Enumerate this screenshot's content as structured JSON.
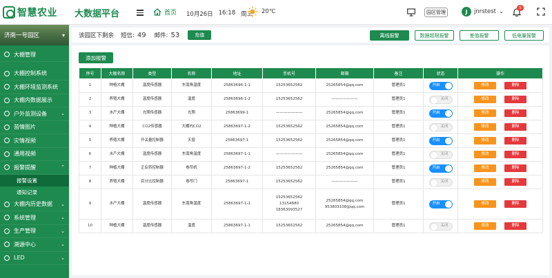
{
  "header": {
    "logo_text": "智慧农业",
    "platform_title": "大数据平台",
    "home_label": "首页",
    "date": "10月26日",
    "time": "16:18",
    "weekday": "周三",
    "temperature": "20℃",
    "park_manage_label": "园区管理",
    "avatar_letter": "J",
    "username": "jnrstest",
    "bell_count": "5"
  },
  "sidebar": {
    "park_name": "济南一号园区",
    "items": [
      {
        "label": "大棚管理",
        "arrow": ""
      },
      {
        "label": "大棚控制系统",
        "arrow": ""
      },
      {
        "label": "大棚环境监测系统",
        "arrow": ""
      },
      {
        "label": "大棚内数据展示",
        "arrow": ""
      },
      {
        "label": "户外监测设备",
        "arrow": "⌄"
      },
      {
        "label": "苗情图片",
        "arrow": ""
      },
      {
        "label": "灾情视频",
        "arrow": ""
      },
      {
        "label": "通用视频",
        "arrow": ""
      },
      {
        "label": "报警提醒",
        "arrow": "⌃"
      },
      {
        "label": "大棚内历史数据",
        "arrow": "⌄"
      },
      {
        "label": "系统管理",
        "arrow": "⌄"
      },
      {
        "label": "生产管理",
        "arrow": "⌄"
      },
      {
        "label": "溯源中心",
        "arrow": "⌄"
      },
      {
        "label": "LED",
        "arrow": "⌄"
      }
    ],
    "sub_items": [
      "报警设置",
      "通知记录"
    ]
  },
  "info_bar": {
    "remaining_label": "该园区下剩余",
    "sms_label": "短信:",
    "sms_count": "49",
    "mail_label": "邮件:",
    "mail_count": "53",
    "recharge_label": "充值",
    "alarm_buttons": [
      "离线报警",
      "数据超限报警",
      "差值报警",
      "低电量报警"
    ]
  },
  "panel": {
    "add_label": "添加报警"
  },
  "table": {
    "headers": [
      "序号",
      "大棚名称",
      "类型",
      "名称",
      "地址",
      "手机号",
      "邮箱",
      "备注",
      "状态",
      "操作"
    ],
    "on_label": "开启",
    "off_label": "关闭",
    "edit_label": "修改",
    "delete_label": "删除",
    "rows": [
      {
        "no": "1",
        "shed": "种植大棚",
        "type": "温度传感器",
        "name": "东南角温度",
        "addr": "25863696-1-1",
        "phone": "15253652562",
        "email": "25265854@qq.com",
        "note": "管理员1",
        "status": "on"
      },
      {
        "no": "2",
        "shed": "养殖大棚",
        "type": "温度传感器",
        "name": "温度",
        "addr": "25863696-1-2",
        "phone": "15253652562",
        "email": "———————",
        "note": "管理员1",
        "status": "off"
      },
      {
        "no": "3",
        "shed": "水产大棚",
        "type": "光照传感器",
        "name": "光照",
        "addr": "25863699-1",
        "phone": "———————",
        "email": "25265854@qq.com",
        "note": "管理员1",
        "status": "on"
      },
      {
        "no": "4",
        "shed": "种植大棚",
        "type": "CO2传感器",
        "name": "大棚内CO2",
        "addr": "25863697-1-2",
        "phone": "15253652562",
        "email": "25265854@qq.com",
        "note": "管理员1",
        "status": "off"
      },
      {
        "no": "5",
        "shed": "养殖大棚",
        "type": "开关量控制器",
        "name": "天窗",
        "addr": "25863697-1",
        "phone": "15253652562",
        "email": "25265854@qq.com",
        "note": "管理员1",
        "status": "on"
      },
      {
        "no": "6",
        "shed": "水产大棚",
        "type": "温度传感器",
        "name": "东南角温度",
        "addr": "25863697-1-1",
        "phone": "———————",
        "email": "25265854@qq.com",
        "note": "管理员1",
        "status": "off"
      },
      {
        "no": "7",
        "shed": "种植大棚",
        "type": "正反转控制器",
        "name": "卷帘机",
        "addr": "25863697-1-2",
        "phone": "15253652562",
        "email": "25265854@qq.com",
        "note": "管理员1",
        "status": "on"
      },
      {
        "no": "8",
        "shed": "养殖大棚",
        "type": "百分比控制器",
        "name": "卷帘门",
        "addr": "25863697-1",
        "phone": "15253652562",
        "email": "———————",
        "note": "管理员1",
        "status": "off"
      },
      {
        "no": "9",
        "shed": "水产大棚",
        "type": "温度传感器",
        "name": "东南角温度",
        "addr": "25863697-1-1",
        "phone": "15253652562\n13154680\n18363093527",
        "email": "25265854@qq.com\n953803108@qq.com",
        "note": "管理员1",
        "status": "on"
      },
      {
        "no": "10",
        "shed": "种植大棚",
        "type": "温度传感器",
        "name": "温度",
        "addr": "25863697-1-1",
        "phone": "15253652562",
        "email": "25265854@qq.com",
        "note": "管理员1",
        "status": "off"
      }
    ]
  }
}
